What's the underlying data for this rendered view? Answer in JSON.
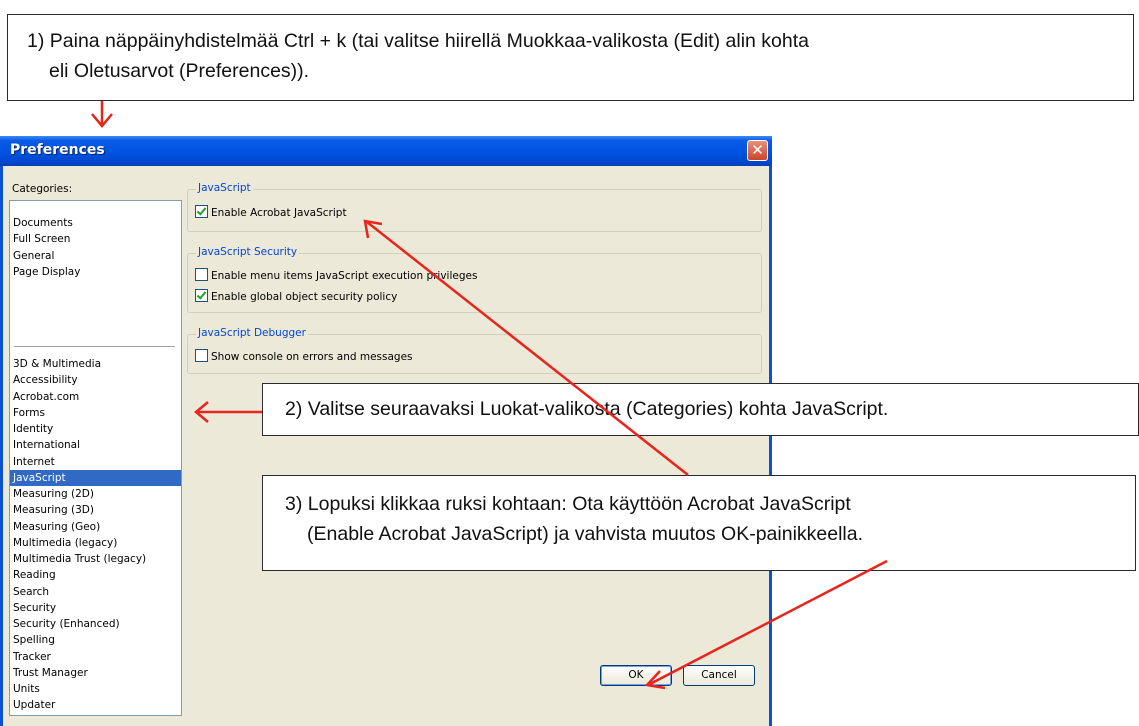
{
  "callouts": {
    "step1": {
      "line1": "1) Paina näppäinyhdistelmää Ctrl + k (tai valitse hiirellä Muokkaa-valikosta (Edit) alin kohta",
      "line2": "eli Oletusarvot (Preferences))."
    },
    "step2": {
      "line1": "2) Valitse seuraavaksi Luokat-valikosta (Categories) kohta JavaScript."
    },
    "step3": {
      "line1": "3) Lopuksi klikkaa ruksi kohtaan: Ota käyttöön Acrobat JavaScript",
      "line2": "(Enable Acrobat JavaScript) ja vahvista muutos OK-painikkeella."
    }
  },
  "dialog": {
    "title": "Preferences",
    "close_glyph": "✕",
    "categories_label": "Categories:",
    "categories_group1": [
      "Documents",
      "Full Screen",
      "General",
      "Page Display"
    ],
    "categories_group2": [
      "3D & Multimedia",
      "Accessibility",
      "Acrobat.com",
      "Forms",
      "Identity",
      "International",
      "Internet",
      "JavaScript",
      "Measuring (2D)",
      "Measuring (3D)",
      "Measuring (Geo)",
      "Multimedia (legacy)",
      "Multimedia Trust (legacy)",
      "Reading",
      "Search",
      "Security",
      "Security (Enhanced)",
      "Spelling",
      "Tracker",
      "Trust Manager",
      "Units",
      "Updater"
    ],
    "selected_category": "JavaScript",
    "groups": {
      "javascript": {
        "title": "JavaScript",
        "enable_acrobat_js": {
          "label": "Enable Acrobat JavaScript",
          "checked": true
        }
      },
      "security": {
        "title": "JavaScript Security",
        "enable_menu_items": {
          "label": "Enable menu items JavaScript execution privileges",
          "checked": false
        },
        "enable_global_object": {
          "label": "Enable global object security policy",
          "checked": true
        }
      },
      "debugger": {
        "title": "JavaScript Debugger",
        "show_console": {
          "label": "Show console on errors and messages",
          "checked": false
        }
      }
    },
    "ok_label": "OK",
    "cancel_label": "Cancel"
  },
  "colors": {
    "arrow": "#e8251c",
    "title_bar": "#0054e3",
    "selection": "#316ac5",
    "group_title": "#0046d5"
  }
}
